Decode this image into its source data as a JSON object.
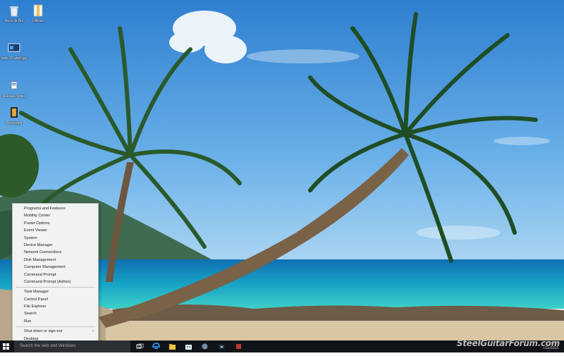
{
  "desktop": {
    "icons": [
      {
        "label": "Recycle Bin",
        "icon": "recycle-bin-icon"
      },
      {
        "label": "Utilities",
        "icon": "folder-icon"
      },
      {
        "label": "wide 10 start.jpg",
        "icon": "image-file-icon"
      },
      {
        "label": "Release Notes",
        "icon": "document-icon"
      },
      {
        "label": "Recording",
        "icon": "media-file-icon"
      }
    ]
  },
  "context_menu": {
    "groups": [
      [
        "Programs and Features",
        "Mobility Center",
        "Power Options",
        "Event Viewer",
        "System",
        "Device Manager",
        "Network Connections",
        "Disk Management",
        "Computer Management",
        "Command Prompt",
        "Command Prompt (Admin)"
      ],
      [
        "Task Manager",
        "Control Panel",
        "File Explorer",
        "Search",
        "Run"
      ],
      [
        "Shut down or sign out",
        "Desktop"
      ]
    ],
    "submenu_arrow": "›"
  },
  "taskbar": {
    "search_placeholder": "Search the web and Windows",
    "icons": [
      "windows-start-icon",
      "task-view-icon",
      "edge-browser-icon",
      "file-explorer-icon",
      "store-icon",
      "app-icon",
      "app-icon",
      "app-icon"
    ],
    "tray": {
      "line1": "9:09 AM",
      "line2": "7/23/2015"
    }
  },
  "watermark": "SteelGuitarForum.com",
  "colors": {
    "taskbar": "#101418",
    "menu_bg": "#f2f2f2",
    "sky": "#3c8fd6",
    "sea": "#1ca3c3"
  }
}
